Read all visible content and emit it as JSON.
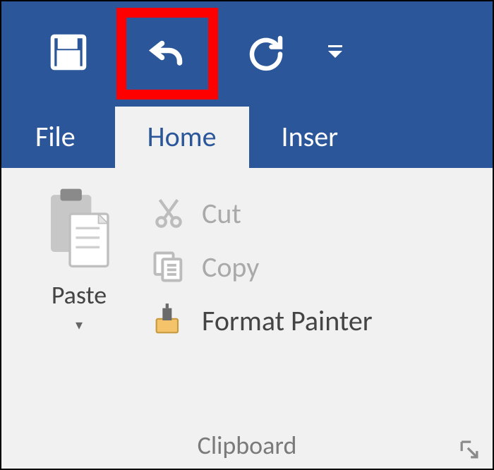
{
  "qat": {
    "highlighted": "undo"
  },
  "tabs": {
    "file": "File",
    "home": "Home",
    "insert": "Inser"
  },
  "clipboard": {
    "paste_label": "Paste",
    "cut_label": "Cut",
    "copy_label": "Copy",
    "format_painter_label": "Format Painter",
    "group_name": "Clipboard"
  },
  "colors": {
    "brand": "#2b579a",
    "highlight": "#ff0000",
    "ribbon_bg": "#f1f1f1",
    "disabled": "#a9a9a9"
  }
}
